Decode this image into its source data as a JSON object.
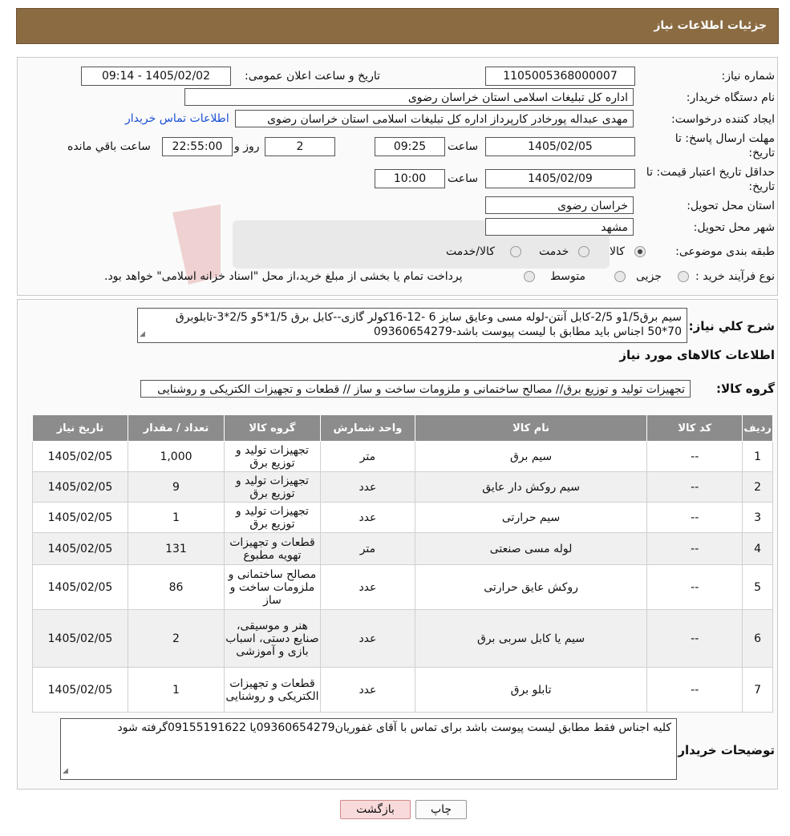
{
  "header": {
    "title": "جزئیات اطلاعات نیاز"
  },
  "form": {
    "need_number_label": "شماره نیاز:",
    "need_number": "1105005368000007",
    "announce_label": "تاریخ و ساعت اعلان عمومی:",
    "announce_value": "1405/02/02 - 09:14",
    "buyer_org_label": "نام دستگاه خریدار:",
    "buyer_org": "اداره کل تبلیغات اسلامی استان خراسان رضوی",
    "requester_label": "ایجاد کننده درخواست:",
    "requester": "مهدی عبداله پورخادر کارپرداز اداره کل تبلیغات اسلامی استان خراسان رضوی",
    "contact_link": "اطلاعات تماس خریدار",
    "deadline_label_1": "مهلت ارسال پاسخ: تا",
    "deadline_label_2": "تاریخ:",
    "deadline_date": "1405/02/05",
    "time_label": "ساعت",
    "deadline_time": "09:25",
    "days_value": "2",
    "days_label": "روز و",
    "remaining_time": "22:55:00",
    "remaining_label": "ساعت باقي مانده",
    "validity_label_1": "حداقل تاریخ اعتبار قیمت: تا",
    "validity_label_2": "تاریخ:",
    "validity_date": "1405/02/09",
    "validity_time": "10:00",
    "province_label": "استان محل تحویل:",
    "province": "خراسان رضوی",
    "city_label": "شهر محل تحویل:",
    "city": "مشهد",
    "category_label": "طبقه بندی موضوعی:",
    "cat_goods": "کالا",
    "cat_service": "خدمت",
    "cat_goods_service": "کالا/خدمت",
    "process_label": "نوع فرآیند خرید :",
    "proc_partial": "جزیی",
    "proc_medium": "متوسط",
    "proc_note": "پرداخت تمام یا بخشی از مبلغ خرید،از محل \"اسناد خزانه اسلامی\" خواهد بود."
  },
  "summary": {
    "label": "شرح کلي نياز:",
    "text": "سیم برق1/5و 2/5-کابل آنتن-لوله مسی وعایق سایز 6 -12-16کولر گازی--کابل برق 1/5*5و 2/5*3-تابلوبرق 70*50 اجناس باید مطابق با لیست پیوست باشد-09360654279"
  },
  "goods_info_title": "اطلاعات کالاهای مورد نیاز",
  "goods_group": {
    "label": "گروه کالا:",
    "value": "تجهیزات تولید و توزیع برق// مصالح ساختمانی و ملزومات ساخت و ساز // قطعات و تجهیزات الکتریکی و روشنایی"
  },
  "table": {
    "headers": [
      "ردیف",
      "کد کالا",
      "نام کالا",
      "واحد شمارش",
      "گروه کالا",
      "تعداد / مقدار",
      "تاریخ نیاز"
    ],
    "rows": [
      [
        "1",
        "--",
        "سیم برق",
        "متر",
        "تجهیزات تولید و توزیع برق",
        "1,000",
        "1405/02/05"
      ],
      [
        "2",
        "--",
        "سیم روکش دار عایق",
        "عدد",
        "تجهیزات تولید و توزیع برق",
        "9",
        "1405/02/05"
      ],
      [
        "3",
        "--",
        "سیم حرارتی",
        "عدد",
        "تجهیزات تولید و توزیع برق",
        "1",
        "1405/02/05"
      ],
      [
        "4",
        "--",
        "لوله مسی صنعتی",
        "متر",
        "قطعات و تجهیزات تهویه مطبوع",
        "131",
        "1405/02/05"
      ],
      [
        "5",
        "--",
        "روکش عایق حرارتی",
        "عدد",
        "مصالح ساختمانی و ملزومات ساخت و ساز",
        "86",
        "1405/02/05"
      ],
      [
        "6",
        "--",
        "سیم یا کابل سربی برق",
        "عدد",
        "هنر و موسیقی، صنایع دستی، اسباب بازی و آموزشی",
        "2",
        "1405/02/05"
      ],
      [
        "7",
        "--",
        "تابلو برق",
        "عدد",
        "قطعات و تجهیزات الکتریکی و روشنایی",
        "1",
        "1405/02/05"
      ]
    ]
  },
  "buyer_notes": {
    "label": "توضیحات خریدار:",
    "text": "کلیه اجناس فقط  مطابق لیست پیوست باشد برای تماس با آقای غفوریان09360654279یا 09155191622گرفته شود"
  },
  "buttons": {
    "print": "چاپ",
    "back": "بازگشت"
  }
}
